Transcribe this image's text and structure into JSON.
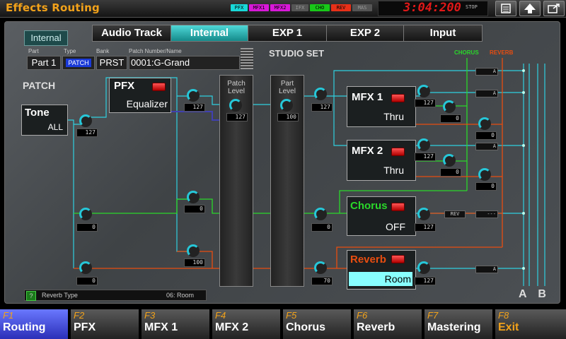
{
  "header": {
    "title": "Effects Routing",
    "indicators": [
      {
        "label": "PFX",
        "color": "#18d8d8"
      },
      {
        "label": "MFX1",
        "color": "#d818d8"
      },
      {
        "label": "MFX2",
        "color": "#d818d8"
      },
      {
        "label": "IFX",
        "color": "#777777"
      },
      {
        "label": "CHO",
        "color": "#18d818"
      },
      {
        "label": "REV",
        "color": "#e83018"
      },
      {
        "label": "MAS",
        "color": "#777777"
      }
    ],
    "clock": "3:04:200",
    "transport": "STOP",
    "icons": [
      "menu-icon",
      "up-arrow-icon",
      "export-icon"
    ]
  },
  "source_button": "Internal",
  "tabs": [
    "Audio Track",
    "Internal",
    "EXP 1",
    "EXP 2",
    "Input"
  ],
  "active_tab": "Internal",
  "fields": {
    "part": {
      "label": "Part",
      "value": "Part 1"
    },
    "type": {
      "label": "Type",
      "value": "PATCH"
    },
    "bank": {
      "label": "Bank",
      "value": "PRST"
    },
    "patch": {
      "label": "Patch Number/Name",
      "value": "0001:G-Grand"
    }
  },
  "studio_set_label": "STUDIO SET",
  "patch_label": "PATCH",
  "tone": {
    "title": "Tone",
    "value": "ALL"
  },
  "pfx": {
    "title": "PFX",
    "value": "Equalizer"
  },
  "mfx1": {
    "title": "MFX 1",
    "value": "Thru"
  },
  "mfx2": {
    "title": "MFX 2",
    "value": "Thru"
  },
  "chorus": {
    "title": "Chorus",
    "value": "OFF"
  },
  "reverb": {
    "title": "Reverb",
    "value": "Room"
  },
  "patch_level": {
    "label1": "Patch",
    "label2": "Level",
    "value": "127"
  },
  "part_level": {
    "label1": "Part",
    "label2": "Level",
    "value": "100"
  },
  "knob_values": {
    "tone_out": "127",
    "pfx_out": "127",
    "mfx_in": "127",
    "mfx1_out": "127",
    "mfx1_cho": "0",
    "mfx1_rev": "0",
    "mfx2_out": "127",
    "mfx2_cho": "0",
    "mfx2_rev": "0",
    "patch_cho": "0",
    "patch_rev": "0",
    "pfx_cho": "0",
    "pfx_rev": "100",
    "part_cho": "0",
    "part_rev": "70",
    "chorus_out": "127",
    "reverb_out": "127"
  },
  "buses": {
    "chorus": "CHORUS",
    "reverb": "REVERB"
  },
  "dest_labels": [
    "A",
    "A",
    "A",
    "A",
    "---",
    "A"
  ],
  "rev_tag": "REV",
  "status": {
    "help_icon": "?",
    "param": "Reverb Type",
    "value": "06: Room"
  },
  "outputs": "A  B",
  "function_keys": [
    {
      "num": "F1",
      "name": "Routing"
    },
    {
      "num": "F2",
      "name": "PFX"
    },
    {
      "num": "F3",
      "name": "MFX 1"
    },
    {
      "num": "F4",
      "name": "MFX 2"
    },
    {
      "num": "F5",
      "name": "Chorus"
    },
    {
      "num": "F6",
      "name": "Reverb"
    },
    {
      "num": "F7",
      "name": "Mastering"
    },
    {
      "num": "F8",
      "name": "Exit"
    }
  ],
  "colors": {
    "accent": "#f2a21a",
    "cyan": "#2fd0e0",
    "green": "#2ad82a",
    "orange": "#e84d10",
    "navy": "#3a3a9a"
  }
}
